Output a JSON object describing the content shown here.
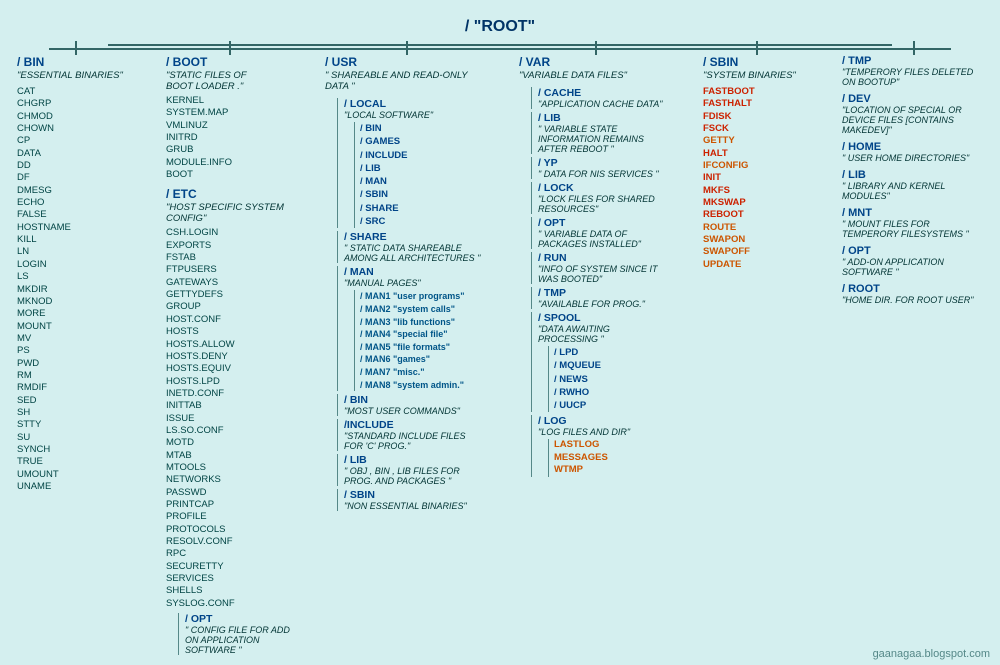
{
  "root": {
    "label": "/  \"ROOT\"",
    "columns": {
      "bin": {
        "title": "/ BIN",
        "desc": "\"ESSENTIAL BINARIES\"",
        "files": [
          "CAT",
          "CHGRP",
          "CHMOD",
          "CHOWN",
          "CP",
          "DATA",
          "DD",
          "DF",
          "DMESG",
          "ECHO",
          "FALSE",
          "HOSTNAME",
          "KILL",
          "LN",
          "LOGIN",
          "LS",
          "MKDIR",
          "MKNOD",
          "MORE",
          "MOUNT",
          "MV",
          "PS",
          "PWD",
          "RM",
          "RMDIF",
          "SED",
          "SH",
          "STTY",
          "SU",
          "SYNCH",
          "TRUE",
          "UMOUNT",
          "UNAME"
        ]
      },
      "boot": {
        "title": "/ BOOT",
        "desc": "\"STATIC FILES OF BOOT LOADER .\"",
        "files": [
          "KERNEL",
          "SYSTEM.MAP",
          "VMLINUZ",
          "INITRD",
          "GRUB",
          "MODULE.INFO",
          "BOOT"
        ]
      },
      "etc": {
        "title": "/ ETC",
        "desc": "\"HOST SPECIFIC SYSTEM CONFIG\"",
        "files": [
          "CSH.LOGIN",
          "EXPORTS",
          "FSTAB",
          "FTPUSERS",
          "GATEWAYS",
          "GETTYDEFS",
          "GROUP",
          "HOST.CONF",
          "HOSTS",
          "HOSTS.ALLOW",
          "HOSTS.DENY",
          "HOSTS.EQUIV",
          "HOSTS.LPD",
          "INETD.CONF",
          "INITTAB",
          "ISSUE",
          "LS.SO.CONF",
          "MOTD",
          "MTAB",
          "MTOOLS",
          "NETWORKS",
          "PASSWD",
          "PRINTCAP",
          "PROFILE",
          "PROTOCOLS",
          "RESOLV.CONF",
          "RPC",
          "SECURETTY",
          "SERVICES",
          "SHELLS",
          "SYSLOG.CONF"
        ],
        "opt": {
          "title": "/ OPT",
          "desc": "\" CONFIG FILE FOR ADD ON APPLICATION SOFTWARE \""
        }
      },
      "usr": {
        "title": "/ USR",
        "desc": "\" SHAREABLE AND READ-ONLY DATA \"",
        "local": {
          "title": "/ LOCAL",
          "desc": "\"LOCAL SOFTWARE\"",
          "subdirs": [
            "/ BIN",
            "/ GAMES",
            "/ INCLUDE",
            "/ LIB",
            "/ MAN",
            "/ SBIN",
            "/ SHARE",
            "/ SRC"
          ]
        },
        "share": {
          "title": "/ SHARE",
          "desc": "\" STATIC DATA SHAREABLE AMONG ALL ARCHITECTURES \""
        },
        "man": {
          "title": "/ MAN",
          "desc": "\"MANUAL PAGES\"",
          "subdirs": [
            "/ MAN1 \"user programs\"",
            "/ MAN2 \"system calls\"",
            "/ MAN3 \"lib functions\"",
            "/ MAN4 \"special file\"",
            "/ MAN5 \"file formats\"",
            "/ MAN6 \"games\"",
            "/ MAN7 \"misc.\"",
            "/ MAN8 \"system admin.\""
          ]
        },
        "bin": {
          "title": "/ BIN",
          "desc": "\"MOST USER COMMANDS\""
        },
        "include": {
          "title": "/ INCLUDE",
          "desc": "\"STANDARD INCLUDE FILES FOR 'C' PROG.\""
        },
        "lib": {
          "title": "/ LIB",
          "desc": "\" OBJ , BIN , LIB FILES FOR PROG. AND PACKAGES \""
        },
        "sbin": {
          "title": "/ SBIN",
          "desc": "\"NON ESSENTIAL BINARIES\""
        }
      },
      "var": {
        "title": "/ VAR",
        "desc": "\"VARIABLE DATA FILES\"",
        "cache": {
          "title": "/ CACHE",
          "desc": "\"APPLICATION CACHE DATA\""
        },
        "lib": {
          "title": "/ LIB",
          "desc": "\" VARIABLE STATE INFORMATION REMAINS AFTER REBOOT \""
        },
        "yp": {
          "title": "/ YP",
          "desc": "\" DATA FOR NIS SERVICES \""
        },
        "lock": {
          "title": "/ LOCK",
          "desc": "\"LOCK FILES FOR SHARED RESOURCES\""
        },
        "opt": {
          "title": "/ OPT",
          "desc": "\" VARIABLE DATA OF PACKAGES INSTALLED\""
        },
        "run": {
          "title": "/ RUN",
          "desc": "\"INFO OF SYSTEM SINCE IT WAS BOOTED\""
        },
        "tmp": {
          "title": "/ TMP",
          "desc": "\"AVAILABLE FOR PROG.\""
        },
        "spool": {
          "title": "/ SPOOL",
          "desc": "\"DATA AWAITING PROCESSING \"",
          "subdirs": [
            "/ LPD",
            "/ MQUEUE",
            "/ NEWS",
            "/ RWHO",
            "/ UUCP"
          ]
        },
        "log": {
          "title": "/ LOG",
          "desc": "\"LOG FILES AND DIR\"",
          "files": [
            "LASTLOG",
            "MESSAGES",
            "WTMP"
          ]
        }
      },
      "sbin": {
        "title": "/ SBIN",
        "desc": "\"SYSTEM BINARIES\"",
        "files_red": [
          "FASTBOOT",
          "FASTHALT",
          "FDISK",
          "FSCK",
          "GETTY",
          "HALT",
          "IFCONFIG",
          "INIT",
          "MKFS",
          "MKSWAP",
          "REBOOT",
          "ROUTE",
          "SWAPON",
          "SWAPOFF",
          "UPDATE"
        ]
      },
      "right": {
        "tmp": {
          "title": "/ TMP",
          "desc": "\"TEMPERORY FILES DELETED ON BOOTUP\""
        },
        "dev": {
          "title": "/ DEV",
          "desc": "\"LOCATION OF SPECIAL OR DEVICE FILES [CONTAINS MAKEDEV]\""
        },
        "home": {
          "title": "/ HOME",
          "desc": "\" USER HOME DIRECTORIES\""
        },
        "lib": {
          "title": "/ LIB",
          "desc": "\"  LIBRARY AND KERNEL MODULES\""
        },
        "mnt": {
          "title": "/ MNT",
          "desc": "\"  MOUNT FILES FOR TEMPERORY FILESYSTEMS \""
        },
        "opt": {
          "title": "/ OPT",
          "desc": "\" ADD-ON APPLICATION SOFTWARE \""
        },
        "root": {
          "title": "/ ROOT",
          "desc": "\"HOME DIR. FOR ROOT USER\""
        }
      }
    }
  },
  "watermark": "gaanagaa.blogspot.com"
}
